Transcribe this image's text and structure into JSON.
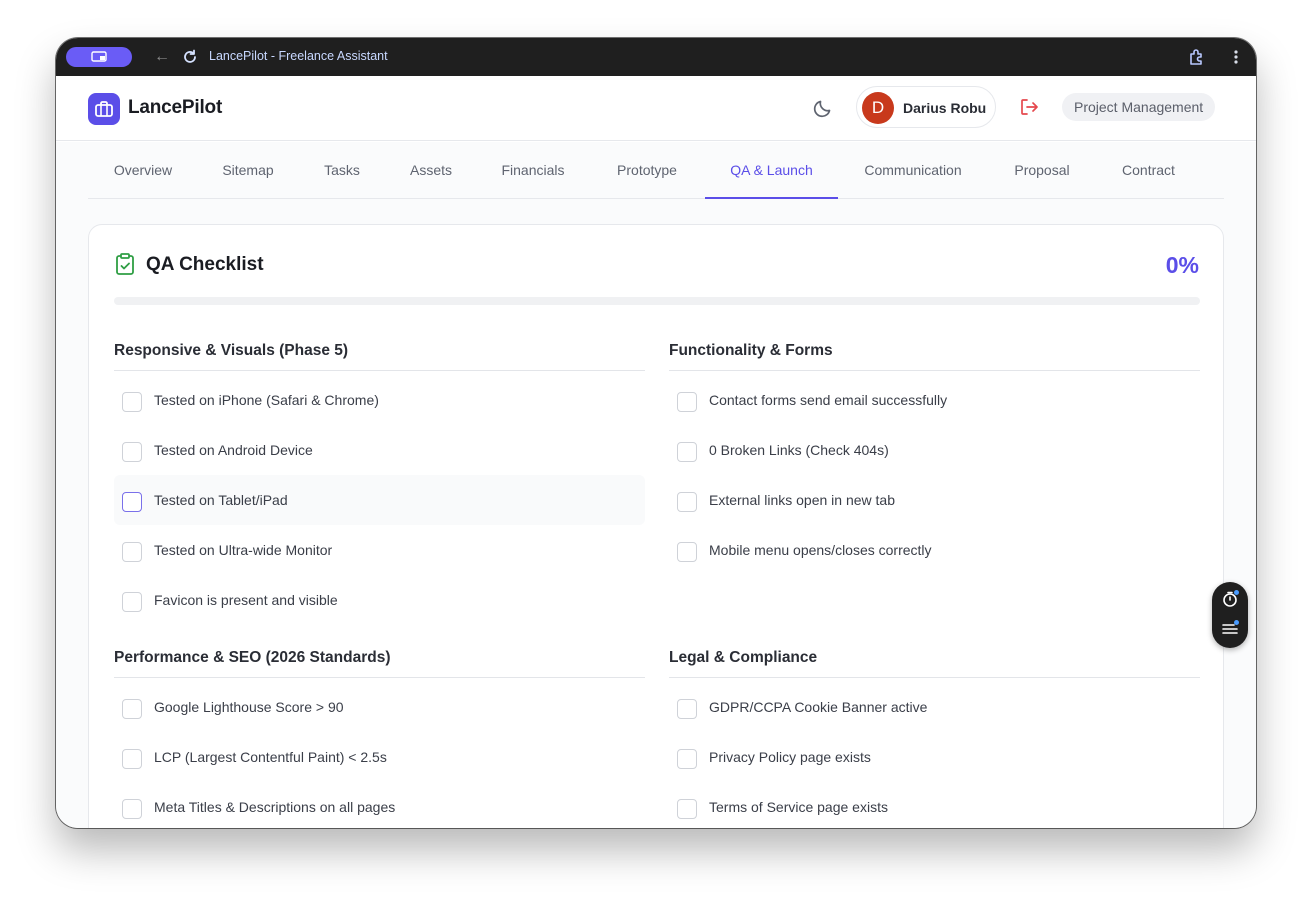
{
  "browser": {
    "title": "LancePilot - Freelance Assistant"
  },
  "header": {
    "brand": "LancePilot",
    "user": {
      "initial": "D",
      "name": "Darius Robu",
      "avatar_color": "#c8391c"
    },
    "context_pill": "Project Management"
  },
  "tabs": [
    {
      "label": "Overview",
      "active": false
    },
    {
      "label": "Sitemap",
      "active": false
    },
    {
      "label": "Tasks",
      "active": false
    },
    {
      "label": "Assets",
      "active": false
    },
    {
      "label": "Financials",
      "active": false
    },
    {
      "label": "Prototype",
      "active": false
    },
    {
      "label": "QA & Launch",
      "active": true
    },
    {
      "label": "Communication",
      "active": false
    },
    {
      "label": "Proposal",
      "active": false
    },
    {
      "label": "Contract",
      "active": false
    }
  ],
  "checklist": {
    "title": "QA Checklist",
    "percent_label": "0%",
    "progress": 0,
    "sections": [
      {
        "title": "Responsive & Visuals (Phase 5)",
        "items": [
          "Tested on iPhone (Safari & Chrome)",
          "Tested on Android Device",
          "Tested on Tablet/iPad",
          "Tested on Ultra-wide Monitor",
          "Favicon is present and visible"
        ]
      },
      {
        "title": "Functionality & Forms",
        "items": [
          "Contact forms send email successfully",
          "0 Broken Links (Check 404s)",
          "External links open in new tab",
          "Mobile menu opens/closes correctly"
        ]
      },
      {
        "title": "Performance & SEO (2026 Standards)",
        "items": [
          "Google Lighthouse Score > 90",
          "LCP (Largest Contentful Paint) < 2.5s",
          "Meta Titles & Descriptions on all pages"
        ]
      },
      {
        "title": "Legal & Compliance",
        "items": [
          "GDPR/CCPA Cookie Banner active",
          "Privacy Policy page exists",
          "Terms of Service page exists"
        ]
      }
    ]
  },
  "colors": {
    "accent": "#5b4ee8",
    "logout": "#e5484d",
    "checklist_icon": "#2f9e44"
  },
  "icons": [
    "screen-share-icon",
    "back-arrow-icon",
    "reload-icon",
    "extension-icon",
    "kebab-menu-icon",
    "briefcase-icon",
    "moon-icon",
    "logout-icon",
    "clipboard-check-icon",
    "timer-icon",
    "list-icon"
  ]
}
